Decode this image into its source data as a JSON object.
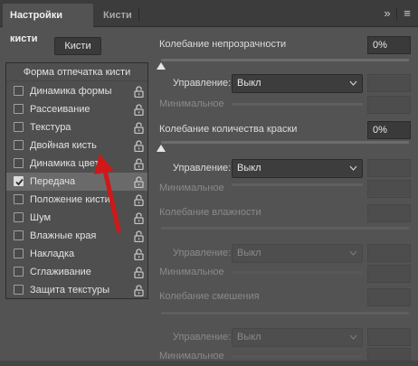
{
  "tabs": [
    {
      "label": "Настройки кисти",
      "active": true
    },
    {
      "label": "Кисти",
      "active": false
    }
  ],
  "toolbar": {
    "expand_glyph": "»",
    "menu_glyph": "≡"
  },
  "left_panel": {
    "brushes_button": "Кисти",
    "list_header": "Форма отпечатка кисти",
    "items": [
      {
        "label": "Динамика формы",
        "checked": false,
        "selected": false
      },
      {
        "label": "Рассеивание",
        "checked": false,
        "selected": false
      },
      {
        "label": "Текстура",
        "checked": false,
        "selected": false
      },
      {
        "label": "Двойная кисть",
        "checked": false,
        "selected": false
      },
      {
        "label": "Динамика цвета",
        "checked": false,
        "selected": false
      },
      {
        "label": "Передача",
        "checked": true,
        "selected": true
      },
      {
        "label": "Положение кисти",
        "checked": false,
        "selected": false
      },
      {
        "label": "Шум",
        "checked": false,
        "selected": false
      },
      {
        "label": "Влажные края",
        "checked": false,
        "selected": false
      },
      {
        "label": "Накладка",
        "checked": false,
        "selected": false
      },
      {
        "label": "Сглаживание",
        "checked": false,
        "selected": false
      },
      {
        "label": "Защита текстуры",
        "checked": false,
        "selected": false
      }
    ]
  },
  "right_panel": {
    "opacity_jitter": {
      "label": "Колебание непрозрачности",
      "value": "0%"
    },
    "opacity_control": {
      "label": "Управление:",
      "value": "Выкл",
      "min_label": "Минимальное"
    },
    "flow_jitter": {
      "label": "Колебание количества краски",
      "value": "0%"
    },
    "flow_control": {
      "label": "Управление:",
      "value": "Выкл",
      "min_label": "Минимальное"
    },
    "wetness_jitter": {
      "label": "Колебание влажности"
    },
    "wetness_control": {
      "label": "Управление:",
      "value": "Выкл",
      "min_label": "Минимальное"
    },
    "mix_jitter": {
      "label": "Колебание смешения"
    },
    "mix_control": {
      "label": "Управление:",
      "value": "Выкл",
      "min_label": "Минимальное"
    }
  },
  "colors": {
    "panel_bg": "#535353",
    "tab_bar": "#3c3c3c",
    "annotation_arrow": "#d01818"
  }
}
